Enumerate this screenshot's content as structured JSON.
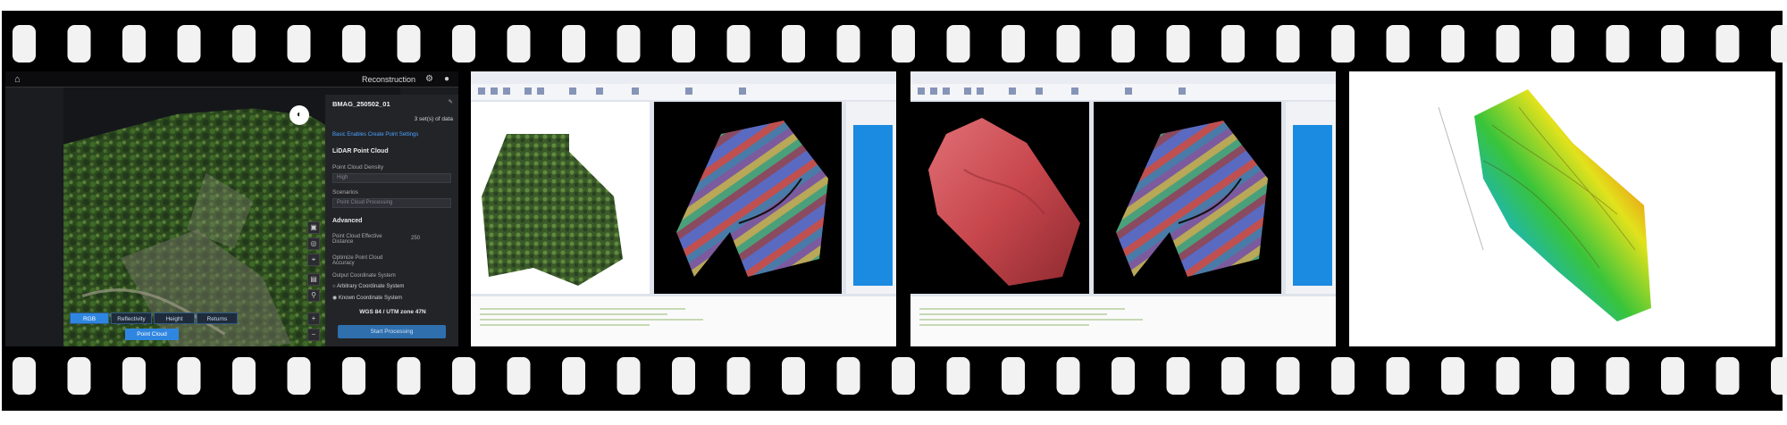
{
  "film_strip": {
    "frame_count": 4,
    "frames": [
      {
        "id": "frame-1",
        "app": {
          "header_title": "Reconstruction",
          "icons": [
            "home-icon",
            "gear-icon",
            "user-icon"
          ]
        },
        "panel": {
          "project_name": "BMAG_250502_01",
          "data_count": "3 set(s) of data",
          "tabs_link": "Basic   Enables   Create  Point Settings",
          "section_lidar": "LiDAR Point Cloud",
          "density_label": "Point Cloud Density",
          "density_value": "High",
          "scenario_label": "Scenarios",
          "scenario_value": "Point Cloud Processing",
          "section_advanced": "Advanced",
          "effective_label": "Point Cloud Effective Distance",
          "effective_value": "250",
          "optimize_label": "Optimize Point Cloud Accuracy",
          "output_cs_label": "Output Coordinate System",
          "cs_option_1": "Arbitrary Coordinate System",
          "cs_option_2": "Known Coordinate System",
          "cs_value": "WGS 84 / UTM zone 47N",
          "start_button": "Start Processing"
        },
        "view_modes": [
          "RGB",
          "Reflectivity",
          "Height",
          "Returns"
        ],
        "active_view_mode": "RGB",
        "point_cloud_button": "Point Cloud"
      },
      {
        "id": "frame-2",
        "content": "point-cloud-software-split-view",
        "left_view": "aerial-orthophoto",
        "right_view": "lidar-strips"
      },
      {
        "id": "frame-3",
        "content": "point-cloud-software-split-view",
        "left_view": "red-terrain-surface",
        "right_view": "lidar-strips"
      },
      {
        "id": "frame-4",
        "content": "elevation-colormap-3d-surface"
      }
    ]
  },
  "colors": {
    "film_black": "#000000",
    "sprocket_white": "#f2f2f2",
    "accent_blue": "#2f86e0",
    "terrain_red": "#c7474d"
  }
}
